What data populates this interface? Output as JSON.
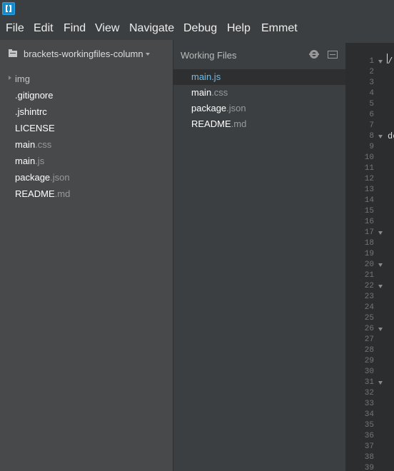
{
  "titlebar": {
    "app_icon": "brackets-logo-icon"
  },
  "menu": {
    "items": [
      {
        "label": "File"
      },
      {
        "label": "Edit"
      },
      {
        "label": "Find"
      },
      {
        "label": "View"
      },
      {
        "label": "Navigate"
      },
      {
        "label": "Debug"
      },
      {
        "label": "Help"
      },
      {
        "label": "Emmet"
      }
    ]
  },
  "sidebar": {
    "project_name": "brackets-workingfiles-column",
    "project_icon": "folder-icon",
    "tree": [
      {
        "name": "img",
        "ext": "",
        "type": "folder"
      },
      {
        "name": ".gitignore",
        "ext": "",
        "type": "file"
      },
      {
        "name": ".jshintrc",
        "ext": "",
        "type": "file"
      },
      {
        "name": "LICENSE",
        "ext": "",
        "type": "file"
      },
      {
        "name": "main",
        "ext": ".css",
        "type": "file"
      },
      {
        "name": "main",
        "ext": ".js",
        "type": "file"
      },
      {
        "name": "package",
        "ext": ".json",
        "type": "file"
      },
      {
        "name": "README",
        "ext": ".md",
        "type": "file"
      }
    ]
  },
  "working_files": {
    "title": "Working Files",
    "settings_icon": "gear-icon",
    "split_icon": "split-view-icon",
    "selected_index": 0,
    "items": [
      {
        "name": "main",
        "ext": ".js"
      },
      {
        "name": "main",
        "ext": ".css"
      },
      {
        "name": "package",
        "ext": ".json"
      },
      {
        "name": "README",
        "ext": ".md"
      }
    ]
  },
  "editor": {
    "line_numbers": [
      "1",
      "2",
      "3",
      "4",
      "5",
      "6",
      "7",
      "8",
      "9",
      "10",
      "11",
      "12",
      "13",
      "14",
      "15",
      "16",
      "17",
      "18",
      "19",
      "20",
      "21",
      "22",
      "23",
      "24",
      "25",
      "26",
      "27",
      "28",
      "29",
      "30",
      "31",
      "32",
      "33",
      "34",
      "35",
      "36",
      "37",
      "38",
      "39"
    ],
    "fold_lines": [
      "1",
      "8",
      "17",
      "20",
      "22",
      "26",
      "31"
    ],
    "code_fragments": [
      {
        "line": "1",
        "text": "/"
      },
      {
        "line": "8",
        "text": "de"
      }
    ]
  },
  "colors": {
    "background": "#3c3f41",
    "sidebar": "#47494a",
    "editor": "#2c2d2e",
    "accent": "#6bbeea",
    "brand": "#1a89c8"
  }
}
